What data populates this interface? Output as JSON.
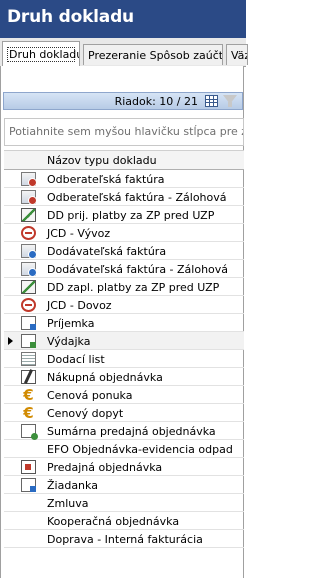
{
  "window": {
    "title": "Druh dokladu"
  },
  "tabs": [
    {
      "label": "Druh dokladu",
      "active": true
    },
    {
      "label": "Prezeranie Spôsob zaúčt.",
      "active": false
    },
    {
      "label": "Väz",
      "active": false
    }
  ],
  "grid": {
    "row_count_label": "Riadok: 10 / 21",
    "group_hint": "Potiahnite sem myšou hlavičku stĺpca pre zoskupenie",
    "column_header": "Názov typu dokladu",
    "rows": [
      {
        "label": "Odberateľská faktúra",
        "icon": "invoice-icon"
      },
      {
        "label": "Odberateľská faktúra - Zálohová",
        "icon": "invoice-icon"
      },
      {
        "label": "DD prij. platby za ZP pred UZP",
        "icon": "zp-payment-icon"
      },
      {
        "label": "JCD - Vývoz",
        "icon": "jcd-icon"
      },
      {
        "label": "Dodávateľská faktúra",
        "icon": "invoice-blue-icon"
      },
      {
        "label": "Dodávateľská faktúra - Zálohová",
        "icon": "invoice-blue-icon"
      },
      {
        "label": "DD zapl. platby za ZP pred UZP",
        "icon": "zp-payment-icon"
      },
      {
        "label": "JCD - Dovoz",
        "icon": "jcd-icon"
      },
      {
        "label": "Príjemka",
        "icon": "receipt-icon"
      },
      {
        "label": "Výdajka",
        "icon": "dispatch-icon",
        "current": true
      },
      {
        "label": "Dodací list",
        "icon": "list-icon"
      },
      {
        "label": "Nákupná objednávka",
        "icon": "order-icon"
      },
      {
        "label": "Cenová ponuka",
        "icon": "euro-icon"
      },
      {
        "label": "Cenový dopyt",
        "icon": "euro-icon"
      },
      {
        "label": "Sumárna predajná objednávka",
        "icon": "sum-icon"
      },
      {
        "label": "EFO Objednávka-evidencia odpad",
        "icon": ""
      },
      {
        "label": "Predajná objednávka",
        "icon": "sales-icon"
      },
      {
        "label": "Žiadanka",
        "icon": "request-icon"
      },
      {
        "label": "Zmluva",
        "icon": ""
      },
      {
        "label": "Kooperačná objednávka",
        "icon": ""
      },
      {
        "label": "Doprava - Interná fakturácia",
        "icon": ""
      }
    ]
  }
}
